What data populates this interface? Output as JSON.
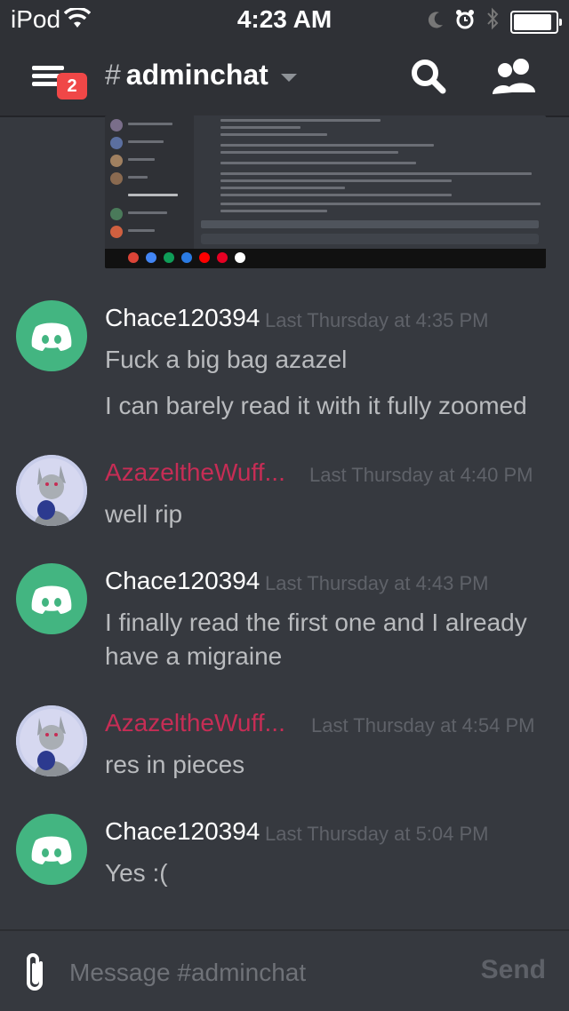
{
  "status_bar": {
    "carrier": "iPod",
    "time": "4:23 AM"
  },
  "header": {
    "menu_badge": "2",
    "channel_hash": "#",
    "channel_name": "adminchat"
  },
  "attachment": {
    "description_icon": "screenshot-image"
  },
  "messages": [
    {
      "author": "Chace120394",
      "timestamp": "Last Thursday at 4:35 PM",
      "lines": [
        "Fuck a big bag azazel",
        "I can barely read it with it fully zoomed"
      ]
    },
    {
      "author": "AzazeltheWuff...",
      "timestamp": "Last Thursday at 4:40 PM",
      "lines": [
        "well rip"
      ]
    },
    {
      "author": "Chace120394",
      "timestamp": "Last Thursday at 4:43 PM",
      "lines": [
        "I finally read the first one and I already have a migraine"
      ]
    },
    {
      "author": "AzazeltheWuff...",
      "timestamp": "Last Thursday at 4:54 PM",
      "lines": [
        "res in pieces"
      ]
    },
    {
      "author": "Chace120394",
      "timestamp": "Last Thursday at 5:04 PM",
      "lines": [
        "Yes :("
      ]
    }
  ],
  "composer": {
    "placeholder": "Message #adminchat",
    "send_label": "Send"
  },
  "colors": {
    "background": "#36393f",
    "header": "#2f3136",
    "discord_green": "#43b581",
    "badge_red": "#f04747",
    "role_pink": "#c62d55"
  }
}
